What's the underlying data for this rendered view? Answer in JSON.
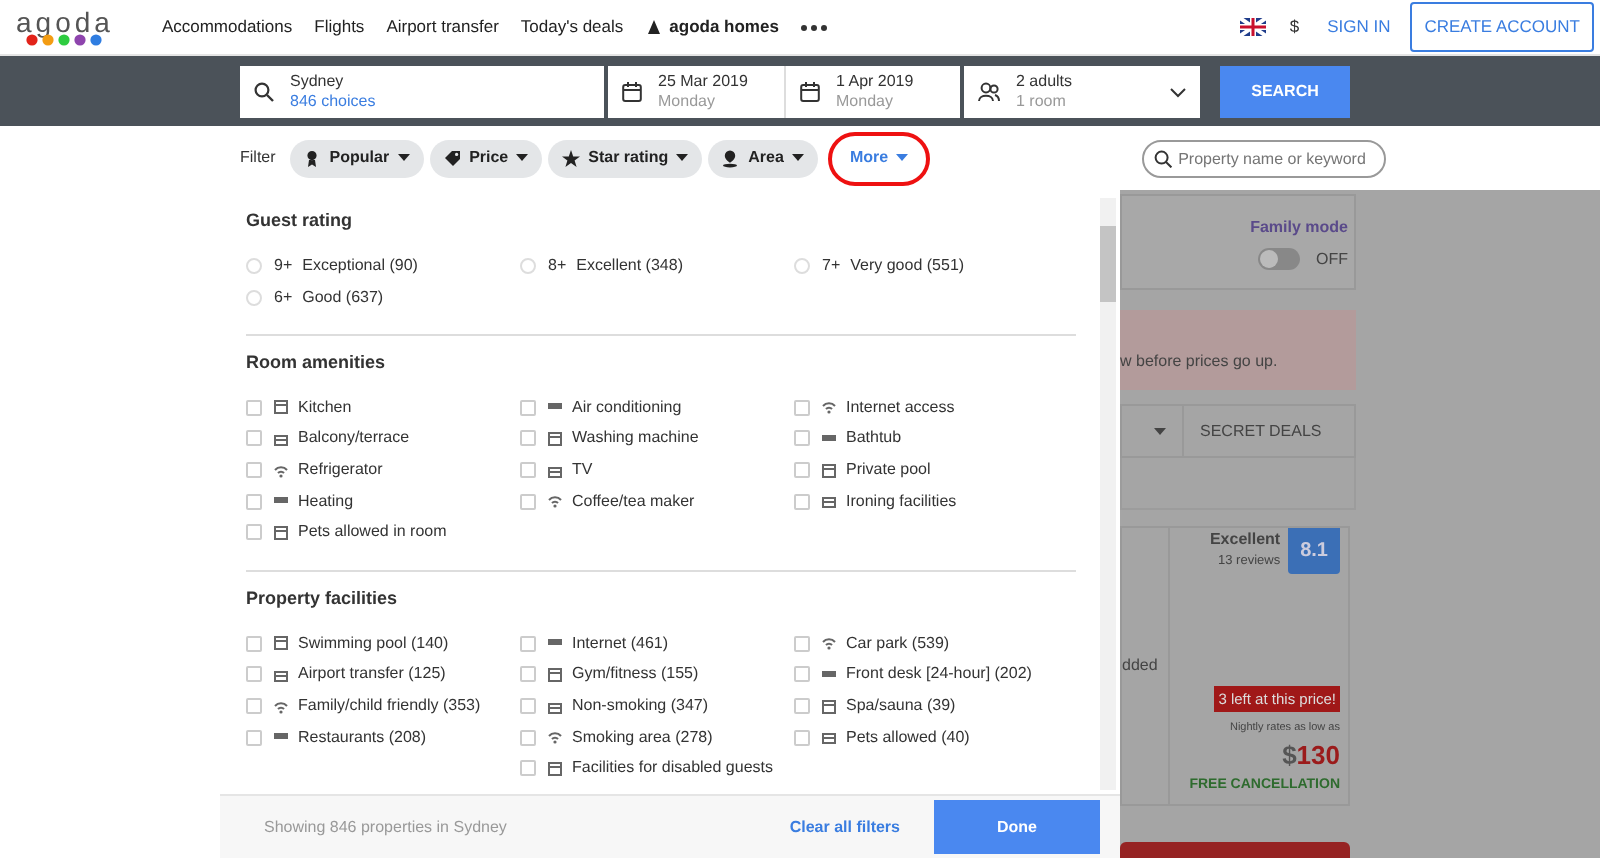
{
  "nav": {
    "logo": "agoda",
    "links": [
      "Accommodations",
      "Flights",
      "Airport transfer",
      "Today's deals",
      "agoda homes"
    ],
    "currency": "$",
    "sign_in": "SIGN IN",
    "create_account": "CREATE ACCOUNT"
  },
  "search": {
    "destination": "Sydney",
    "choices": "846 choices",
    "check_in": {
      "date": "25 Mar 2019",
      "day": "Monday"
    },
    "check_out": {
      "date": "1 Apr 2019",
      "day": "Monday"
    },
    "guests": {
      "adults": "2 adults",
      "rooms": "1 room"
    },
    "button": "SEARCH"
  },
  "filter_bar": {
    "label": "Filter",
    "chips": [
      {
        "label": "Popular",
        "selected": false,
        "highlighted": false
      },
      {
        "label": "Price",
        "selected": false,
        "highlighted": false
      },
      {
        "label": "Star rating",
        "selected": false,
        "highlighted": false
      },
      {
        "label": "Area",
        "selected": false,
        "highlighted": false
      },
      {
        "label": "More",
        "selected": true,
        "highlighted": true
      }
    ],
    "search": {
      "placeholder": "Property name or keyword"
    }
  },
  "panel": {
    "sections": [
      {
        "title": "Guest rating",
        "kind": "radio",
        "options": [
          {
            "prefix": "9+",
            "label": "Exceptional (90)",
            "checked": false
          },
          {
            "prefix": "8+",
            "label": "Excellent (348)",
            "checked": false
          },
          {
            "prefix": "7+",
            "label": "Very good (551)",
            "checked": false
          },
          {
            "prefix": "6+",
            "label": "Good (637)",
            "checked": false
          }
        ]
      },
      {
        "title": "Room amenities",
        "kind": "checkbox",
        "options": [
          {
            "label": "Kitchen",
            "checked": false
          },
          {
            "label": "Air conditioning",
            "checked": false
          },
          {
            "label": "Internet access",
            "checked": false
          },
          {
            "label": "Balcony/terrace",
            "checked": false
          },
          {
            "label": "Washing machine",
            "checked": false
          },
          {
            "label": "Bathtub",
            "checked": false
          },
          {
            "label": "Refrigerator",
            "checked": false
          },
          {
            "label": "TV",
            "checked": false
          },
          {
            "label": "Private pool",
            "checked": false
          },
          {
            "label": "Heating",
            "checked": false
          },
          {
            "label": "Coffee/tea maker",
            "checked": false
          },
          {
            "label": "Ironing facilities",
            "checked": false
          },
          {
            "label": "Pets allowed in room",
            "checked": false
          }
        ]
      },
      {
        "title": "Property facilities",
        "kind": "checkbox",
        "options": [
          {
            "label": "Swimming pool (140)",
            "checked": false
          },
          {
            "label": "Internet (461)",
            "checked": false
          },
          {
            "label": "Car park (539)",
            "checked": false
          },
          {
            "label": "Airport transfer (125)",
            "checked": false
          },
          {
            "label": "Gym/fitness (155)",
            "checked": false
          },
          {
            "label": "Front desk [24-hour] (202)",
            "checked": false
          },
          {
            "label": "Family/child friendly (353)",
            "checked": false
          },
          {
            "label": "Non-smoking (347)",
            "checked": false
          },
          {
            "label": "Spa/sauna (39)",
            "checked": false
          },
          {
            "label": "Restaurants (208)",
            "checked": false
          },
          {
            "label": "Smoking area (278)",
            "checked": false
          },
          {
            "label": "Pets allowed (40)",
            "checked": false
          },
          {
            "label": "Facilities for disabled guests",
            "checked": false
          }
        ]
      }
    ],
    "footer": {
      "summary": "Showing 846 properties in Sydney",
      "clear": "Clear all filters",
      "done": "Done"
    }
  },
  "background": {
    "family_mode": {
      "label": "Family mode",
      "on": false,
      "state": "OFF"
    },
    "alert": "w before prices go up.",
    "tab": "SECRET DEALS",
    "hotel": {
      "rating": "Excellent",
      "reviews": "13 reviews",
      "score": "8.1",
      "snippet": "dded",
      "urgency": "3 left at this price!",
      "rate_note": "Nightly rates as low as",
      "currency": "$",
      "price": "130",
      "cancellation": "FREE CANCELLATION"
    }
  }
}
